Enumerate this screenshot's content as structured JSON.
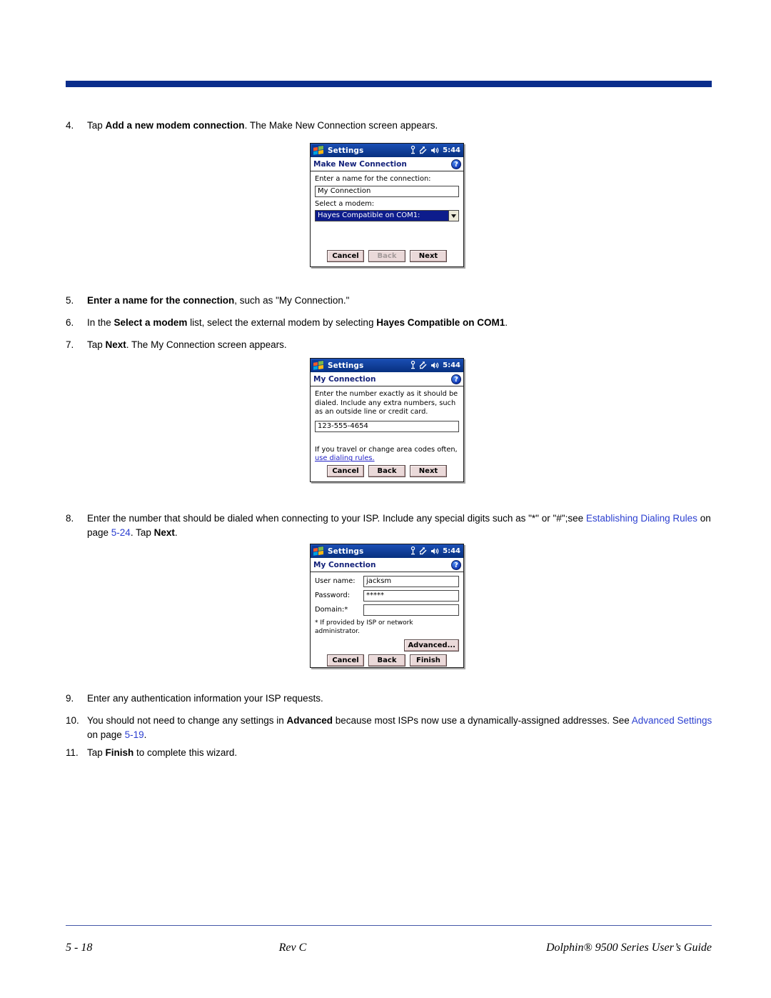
{
  "page": {
    "header_bar_color": "#0a2e8c",
    "link_color": "#2b3fd0"
  },
  "steps": [
    {
      "num": "4.",
      "parts": [
        {
          "t": "Tap ",
          "s": "n"
        },
        {
          "t": "Add a new modem connection",
          "s": "b"
        },
        {
          "t": ". The Make New Connection screen appears.",
          "s": "n"
        }
      ]
    },
    {
      "num": "5.",
      "parts": [
        {
          "t": "Enter a name for the connection",
          "s": "b"
        },
        {
          "t": ", such as \"My Connection.\"",
          "s": "n"
        }
      ]
    },
    {
      "num": "6.",
      "parts": [
        {
          "t": "In the ",
          "s": "n"
        },
        {
          "t": "Select a modem",
          "s": "b"
        },
        {
          "t": " list, select the external modem by selecting ",
          "s": "n"
        },
        {
          "t": "Hayes Compatible on COM1",
          "s": "b"
        },
        {
          "t": ".",
          "s": "n"
        }
      ]
    },
    {
      "num": "7.",
      "parts": [
        {
          "t": "Tap ",
          "s": "n"
        },
        {
          "t": "Next",
          "s": "b"
        },
        {
          "t": ". The My Connection screen appears.",
          "s": "n"
        }
      ]
    },
    {
      "num": "8.",
      "parts": [
        {
          "t": "Enter the number that should be dialed when connecting to your ISP. Include any special digits such as \"*\" or \"#\";see ",
          "s": "n"
        },
        {
          "t": "Establishing Dialing Rules",
          "s": "l"
        },
        {
          "t": " on page ",
          "s": "n"
        },
        {
          "t": "5-24",
          "s": "l"
        },
        {
          "t": ". Tap ",
          "s": "n"
        },
        {
          "t": "Next",
          "s": "b"
        },
        {
          "t": ".",
          "s": "n"
        }
      ]
    },
    {
      "num": "9.",
      "parts": [
        {
          "t": "Enter any authentication information your ISP requests.",
          "s": "n"
        }
      ]
    },
    {
      "num": "10.",
      "parts": [
        {
          "t": "You should not need to change any settings in ",
          "s": "n"
        },
        {
          "t": "Advanced",
          "s": "b"
        },
        {
          "t": " because most ISPs now use a dynamically-assigned addresses. See ",
          "s": "n"
        },
        {
          "t": "Advanced Settings",
          "s": "l"
        },
        {
          "t": " on page ",
          "s": "n"
        },
        {
          "t": "5-19",
          "s": "l"
        },
        {
          "t": ".",
          "s": "n"
        }
      ]
    },
    {
      "num": "11.",
      "parts": [
        {
          "t": "Tap ",
          "s": "n"
        },
        {
          "t": "Finish",
          "s": "b"
        },
        {
          "t": " to complete this wizard.",
          "s": "n"
        }
      ]
    }
  ],
  "screens": [
    {
      "app_title": "Settings",
      "clock": "5:44",
      "screen_title": "Make New Connection",
      "help_label": "?",
      "name_label": "Enter a name for the connection:",
      "name_value": "My Connection",
      "modem_label": "Select a modem:",
      "modem_value": "Hayes Compatible on COM1:",
      "buttons": [
        {
          "label": "Cancel",
          "disabled": false
        },
        {
          "label": "Back",
          "disabled": true
        },
        {
          "label": "Next",
          "disabled": false
        }
      ]
    },
    {
      "app_title": "Settings",
      "clock": "5:44",
      "screen_title": "My Connection",
      "help_label": "?",
      "instructions": "Enter the number exactly as it should be dialed.  Include any extra numbers, such as an outside line or credit card.",
      "number_value": "123-555-4654",
      "dialing_text": "If you travel or change area codes often,",
      "dialing_link": "use dialing rules.",
      "buttons": [
        {
          "label": "Cancel",
          "disabled": false
        },
        {
          "label": "Back",
          "disabled": false
        },
        {
          "label": "Next",
          "disabled": false
        }
      ]
    },
    {
      "app_title": "Settings",
      "clock": "5:44",
      "screen_title": "My Connection",
      "help_label": "?",
      "fields": [
        {
          "label": "User name:",
          "value": "jacksm"
        },
        {
          "label": "Password:",
          "value": "*****"
        },
        {
          "label": "Domain:*",
          "value": ""
        }
      ],
      "footnote": "* If provided by ISP or network administrator.",
      "advanced_label": "Advanced...",
      "buttons": [
        {
          "label": "Cancel",
          "disabled": false
        },
        {
          "label": "Back",
          "disabled": false
        },
        {
          "label": "Finish",
          "disabled": false
        }
      ]
    }
  ],
  "footer": {
    "page_number": "5 - 18",
    "revision": "Rev C",
    "guide_title": "Dolphin® 9500 Series User’s Guide"
  }
}
